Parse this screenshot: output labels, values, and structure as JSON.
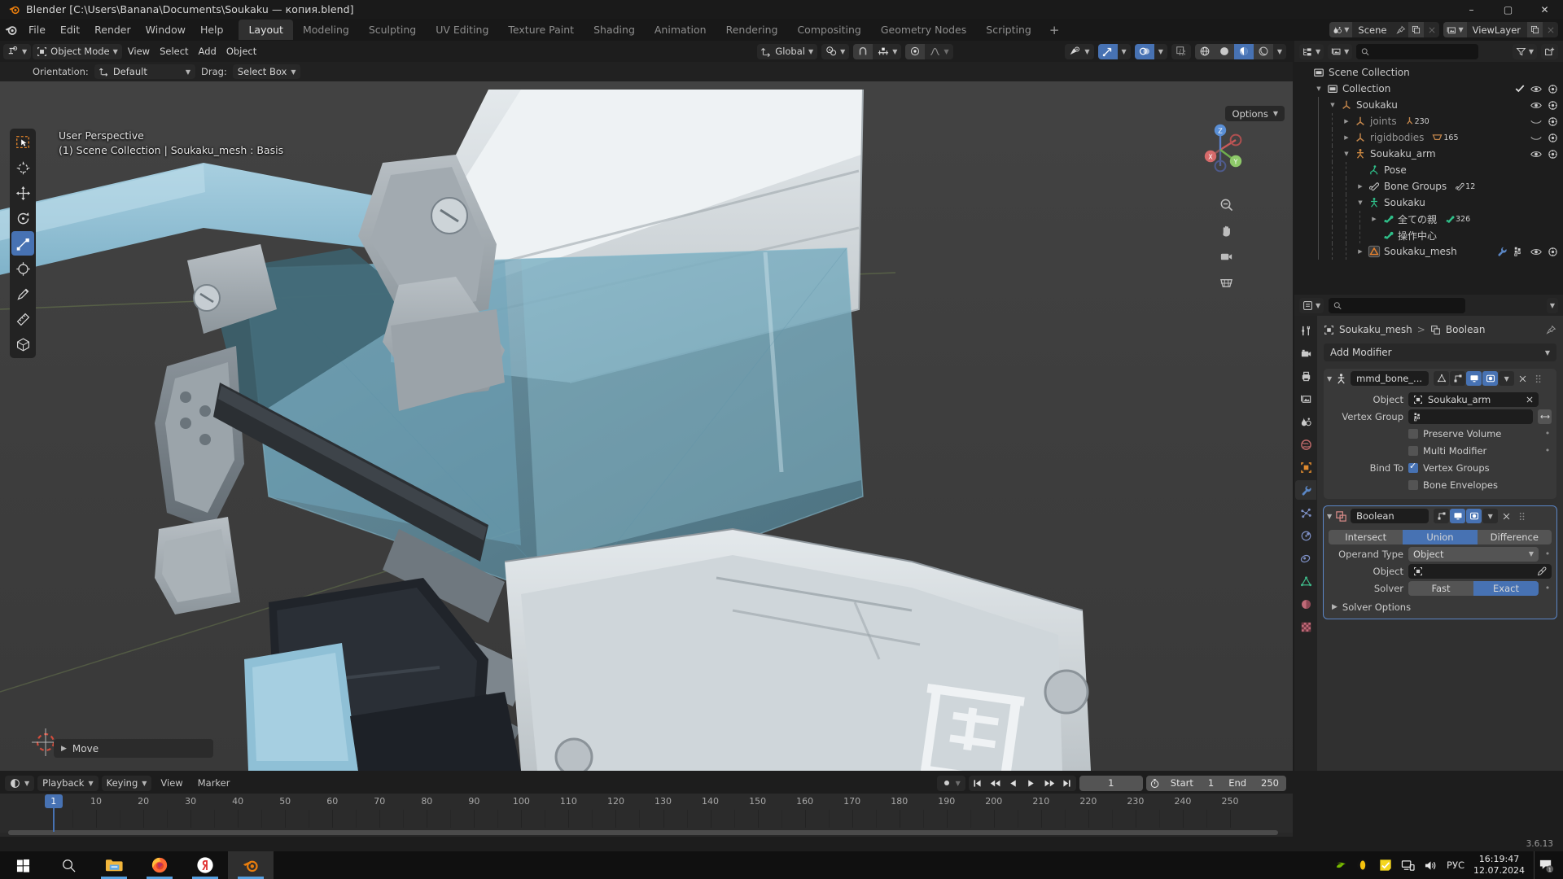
{
  "window": {
    "title": "Blender [C:\\Users\\Banana\\Documents\\Soukaku — копия.blend]",
    "minimize": "–",
    "maximize": "▢",
    "close": "✕"
  },
  "topbar": {
    "menus": [
      "File",
      "Edit",
      "Render",
      "Window",
      "Help"
    ],
    "workspaces": [
      {
        "label": "Layout",
        "active": true
      },
      {
        "label": "Modeling",
        "active": false
      },
      {
        "label": "Sculpting",
        "active": false
      },
      {
        "label": "UV Editing",
        "active": false
      },
      {
        "label": "Texture Paint",
        "active": false
      },
      {
        "label": "Shading",
        "active": false
      },
      {
        "label": "Animation",
        "active": false
      },
      {
        "label": "Rendering",
        "active": false
      },
      {
        "label": "Compositing",
        "active": false
      },
      {
        "label": "Geometry Nodes",
        "active": false
      },
      {
        "label": "Scripting",
        "active": false
      }
    ],
    "add_workspace": "+",
    "scene_name": "Scene",
    "viewlayer_name": "ViewLayer"
  },
  "viewport": {
    "mode": "Object Mode",
    "menus": [
      "View",
      "Select",
      "Add",
      "Object"
    ],
    "transform_orientation": "Global",
    "orientation_label": "Orientation:",
    "orientation_value": "Default",
    "drag_label": "Drag:",
    "drag_value": "Select Box",
    "options_label": "Options",
    "overlay_line1": "User Perspective",
    "overlay_line2": "(1) Scene Collection | Soukaku_mesh : Basis",
    "operator_panel": "Move",
    "gizmo_axes": {
      "x": "X",
      "y": "Y",
      "z": "Z"
    }
  },
  "outliner": {
    "search_placeholder": "",
    "items": [
      {
        "label": "Scene Collection",
        "depth": 0,
        "icon": "collection-icon",
        "disclosure": "",
        "badge": "",
        "eye": false,
        "camera": false,
        "check": false
      },
      {
        "label": "Collection",
        "depth": 1,
        "icon": "collection-icon",
        "disclosure": "▼",
        "badge": "",
        "eye": true,
        "camera": true,
        "check": true
      },
      {
        "label": "Soukaku",
        "depth": 2,
        "icon": "empty-icon",
        "disclosure": "▼",
        "badge": "",
        "eye": true,
        "camera": true,
        "check": false
      },
      {
        "label": "joints",
        "depth": 3,
        "icon": "empty-icon",
        "disclosure": "▶",
        "badge": "230",
        "eye": false,
        "camera": true,
        "check": false,
        "dim": true
      },
      {
        "label": "rigidbodies",
        "depth": 3,
        "icon": "empty-icon",
        "disclosure": "▶",
        "badge": "165",
        "eye": false,
        "camera": true,
        "check": false,
        "dim": true
      },
      {
        "label": "Soukaku_arm",
        "depth": 3,
        "icon": "armature-icon",
        "disclosure": "▼",
        "badge": "",
        "eye": true,
        "camera": true,
        "check": false
      },
      {
        "label": "Pose",
        "depth": 4,
        "icon": "pose-icon",
        "disclosure": "",
        "badge": "",
        "eye": false,
        "camera": false,
        "check": false
      },
      {
        "label": "Bone Groups",
        "depth": 4,
        "icon": "bonegroup-icon",
        "disclosure": "▶",
        "badge": "12",
        "eye": false,
        "camera": false,
        "check": false
      },
      {
        "label": "Soukaku",
        "depth": 4,
        "icon": "armature-data-icon",
        "disclosure": "▼",
        "badge": "",
        "eye": false,
        "camera": false,
        "check": false
      },
      {
        "label": "全ての親",
        "depth": 5,
        "icon": "bone-icon",
        "disclosure": "▶",
        "badge": "326",
        "eye": false,
        "camera": false,
        "check": false
      },
      {
        "label": "操作中心",
        "depth": 5,
        "icon": "bone-icon",
        "disclosure": "",
        "badge": "",
        "eye": false,
        "camera": false,
        "check": false
      },
      {
        "label": "Soukaku_mesh",
        "depth": 4,
        "icon": "mesh-icon",
        "disclosure": "▶",
        "badge": "",
        "eye": true,
        "camera": true,
        "check": false,
        "extra": [
          "wrench-icon",
          "vertexgroup-icon"
        ]
      }
    ]
  },
  "properties": {
    "breadcrumb_object": "Soukaku_mesh",
    "breadcrumb_sep": ">",
    "breadcrumb_leaf": "Boolean",
    "add_modifier": "Add Modifier",
    "modifiers": [
      {
        "name": "mmd_bone_...",
        "type": "armature",
        "selected": false,
        "rows": [
          {
            "kind": "field",
            "label": "Object",
            "value": "Soukaku_arm",
            "icon": "object-icon",
            "close": true
          },
          {
            "kind": "field",
            "label": "Vertex Group",
            "value": "",
            "icon": "vertexgroup-icon",
            "swap": true
          },
          {
            "kind": "check",
            "label": "",
            "text": "Preserve Volume",
            "checked": false,
            "dot": true
          },
          {
            "kind": "check",
            "label": "",
            "text": "Multi Modifier",
            "checked": false,
            "dot": true
          },
          {
            "kind": "check",
            "label": "Bind To",
            "text": "Vertex Groups",
            "checked": true,
            "dot": false
          },
          {
            "kind": "check",
            "label": "",
            "text": "Bone Envelopes",
            "checked": false,
            "dot": false
          }
        ]
      },
      {
        "name": "Boolean",
        "type": "boolean",
        "selected": true,
        "operation": {
          "options": [
            "Intersect",
            "Union",
            "Difference"
          ],
          "selected": "Union"
        },
        "rows": [
          {
            "kind": "dropdown",
            "label": "Operand Type",
            "value": "Object",
            "dot": true
          },
          {
            "kind": "field",
            "label": "Object",
            "value": "",
            "icon": "object-icon",
            "eyedropper": true
          },
          {
            "kind": "segment",
            "label": "Solver",
            "options": [
              "Fast",
              "Exact"
            ],
            "selected": "Exact",
            "dot": true
          }
        ],
        "solver_options": "Solver Options"
      }
    ]
  },
  "timeline": {
    "editor_menus": [
      "Playback",
      "Keying",
      "View",
      "Marker"
    ],
    "ruler_ticks": [
      10,
      20,
      30,
      40,
      50,
      60,
      70,
      80,
      90,
      100,
      110,
      120,
      130,
      140,
      150,
      160,
      170,
      180,
      190,
      200,
      210,
      220,
      230,
      240,
      250
    ],
    "current_frame": "1",
    "start_label": "Start",
    "start_value": "1",
    "end_label": "End",
    "end_value": "250",
    "playhead_frame": "1"
  },
  "statusbar": {
    "version": "3.6.13"
  },
  "taskbar": {
    "apps": [
      "windows-start-icon",
      "search-icon",
      "file-explorer-icon",
      "firefox-icon",
      "yandex-icon",
      "blender-icon"
    ],
    "tray_icons": [
      "nvidia-icon",
      "opera-icon",
      "notes-icon",
      "network-icon",
      "volume-icon"
    ],
    "language": "РУС",
    "time": "16:19:47",
    "date": "12.07.2024",
    "notification_count": "1"
  },
  "colors": {
    "accent": "#4772b3",
    "panel": "#303030",
    "header": "#1d1d1d",
    "orange": "#e87d0d"
  }
}
